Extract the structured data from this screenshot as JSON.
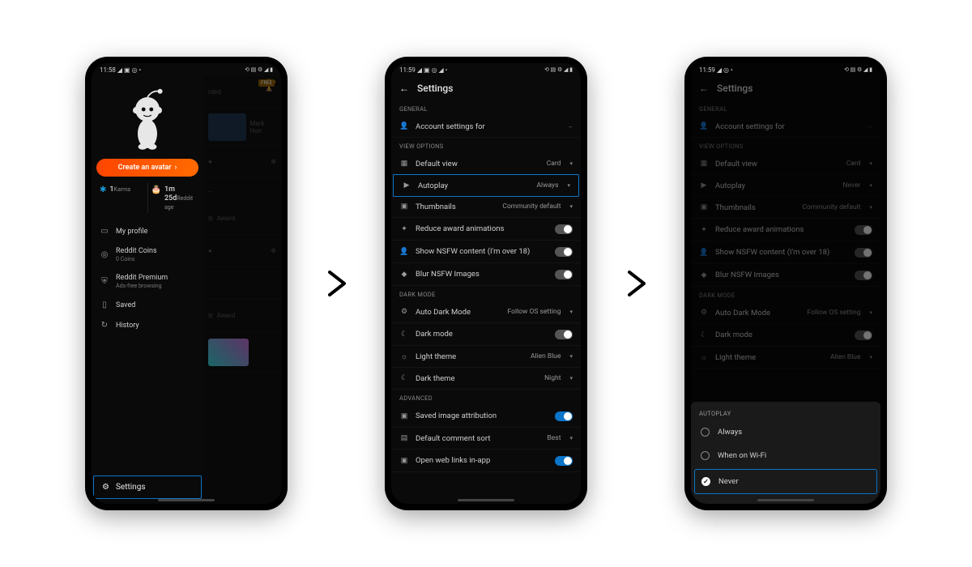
{
  "statusbars": {
    "p1": {
      "time": "11:58",
      "icons_left": "◢ ▣ ◎ •",
      "icons_right": "⟲ ▤ ⚙ ◢ ▮"
    },
    "p2": {
      "time": "11:59",
      "icons_left": "◢ ▣ ◎ ◢ •",
      "icons_right": "⟲ ▤ ⚙ ◢ ▮"
    },
    "p3": {
      "time": "11:59",
      "icons_left": "◢ ◎ •",
      "icons_right": "⟲ ▤ ⚙ ◢ ▮"
    }
  },
  "phone1": {
    "free_badge": "FREE",
    "cta": "Create an avatar",
    "stats": {
      "karma_value": "1",
      "karma_label": "Karma",
      "age_value": "1m 25d",
      "age_label": "Reddit age"
    },
    "menu": {
      "profile": "My profile",
      "coins": "Reddit Coins",
      "coins_sub": "0 Coins",
      "premium": "Reddit Premium",
      "premium_sub": "Ads-free browsing",
      "saved": "Saved",
      "history": "History"
    },
    "settings": "Settings",
    "bg": {
      "label1": "rded",
      "label2": "Mark Hun",
      "award": "Award"
    }
  },
  "phone2": {
    "title": "Settings",
    "sections": {
      "general": "GENERAL",
      "view": "VIEW OPTIONS",
      "dark": "DARK MODE",
      "advanced": "ADVANCED"
    },
    "rows": {
      "account": "Account settings for",
      "default_view": "Default view",
      "default_view_val": "Card",
      "autoplay": "Autoplay",
      "autoplay_val": "Always",
      "thumbnails": "Thumbnails",
      "thumbnails_val": "Community default",
      "reduce_anim": "Reduce award animations",
      "nsfw": "Show NSFW content (I'm over 18)",
      "blur": "Blur NSFW Images",
      "auto_dark": "Auto Dark Mode",
      "auto_dark_val": "Follow OS setting",
      "dark_mode": "Dark mode",
      "light_theme": "Light theme",
      "light_theme_val": "Alien Blue",
      "dark_theme": "Dark theme",
      "dark_theme_val": "Night",
      "saved_attr": "Saved image attribution",
      "comment_sort": "Default comment sort",
      "comment_sort_val": "Best",
      "open_links": "Open web links in-app"
    }
  },
  "phone3": {
    "title": "Settings",
    "rows": {
      "autoplay_val": "Never"
    },
    "sheet": {
      "title": "AUTOPLAY",
      "opt1": "Always",
      "opt2": "When on Wi-Fi",
      "opt3": "Never"
    }
  }
}
